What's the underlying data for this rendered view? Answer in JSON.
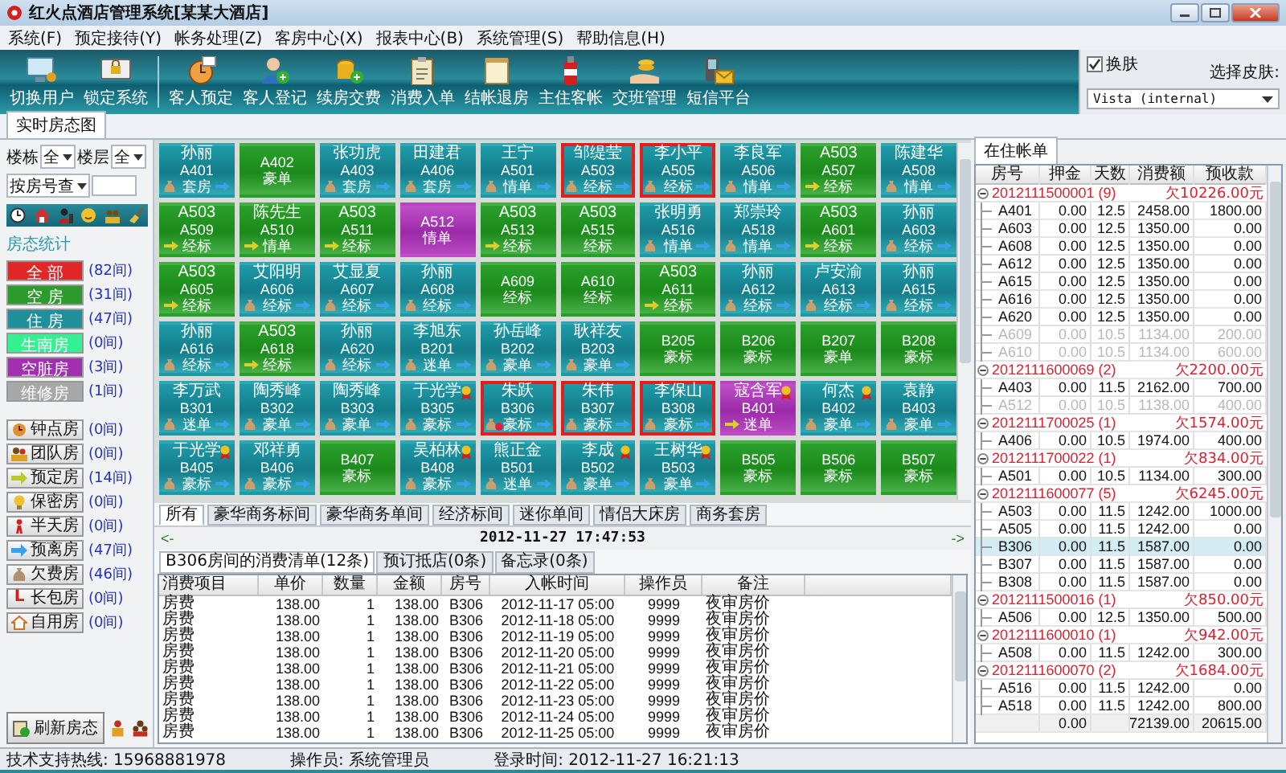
{
  "window": {
    "title": "红火点酒店管理系统[某某大酒店]"
  },
  "menu": [
    "系统(F)",
    "预定接待(Y)",
    "帐务处理(Z)",
    "客房中心(X)",
    "报表中心(B)",
    "系统管理(S)",
    "帮助信息(H)"
  ],
  "toolbar": {
    "system": [
      {
        "label": "切换用户",
        "kind": "user"
      },
      {
        "label": "锁定系统",
        "kind": "lock"
      }
    ],
    "guest": [
      {
        "label": "客人预定",
        "kind": "clock"
      },
      {
        "label": "客人登记",
        "kind": "person-add"
      },
      {
        "label": "续房交费",
        "kind": "coins"
      },
      {
        "label": "消费入单",
        "kind": "clipboard"
      },
      {
        "label": "结帐退房",
        "kind": "note"
      },
      {
        "label": "主住客帐",
        "kind": "bottle"
      },
      {
        "label": "交班管理",
        "kind": "hand"
      },
      {
        "label": "短信平台",
        "kind": "phone"
      }
    ]
  },
  "skin": {
    "toggle_label": "换肤",
    "checked": true,
    "label": "选择皮肤:",
    "value": "Vista (internal)"
  },
  "main_tabs": [
    {
      "label": "实时房态图",
      "selected": true
    }
  ],
  "filters": {
    "building_label": "楼栋",
    "building": "全",
    "floor_label": "楼层",
    "floor": "全",
    "search_mode": "按房号查"
  },
  "status_heading": "房态统计",
  "status_counts": [
    {
      "label": "全 部",
      "count": "(82间)",
      "color": "#e02828"
    },
    {
      "label": "空 房",
      "count": "(31间)",
      "color": "#2c9a2c"
    },
    {
      "label": "住 房",
      "count": "(47间)",
      "color": "#1f8f99"
    },
    {
      "label": "生南房",
      "count": "(0间)",
      "color": "#33f090"
    },
    {
      "label": "空脏房",
      "count": "(3间)",
      "color": "#a030b0"
    },
    {
      "label": "维修房",
      "count": "(1间)",
      "color": "#a8a8a8"
    }
  ],
  "room_types": [
    {
      "label": "钟点房",
      "count": "(0间)",
      "kind": "clock"
    },
    {
      "label": "团队房",
      "count": "(0间)",
      "kind": "team"
    },
    {
      "label": "预定房",
      "count": "(14间)",
      "kind": "reserve"
    },
    {
      "label": "保密房",
      "count": "(0间)",
      "kind": "bulb"
    },
    {
      "label": "半天房",
      "count": "(0间)",
      "kind": "half"
    },
    {
      "label": "预离房",
      "count": "(47间)",
      "kind": "leave"
    },
    {
      "label": "欠费房",
      "count": "(46间)",
      "kind": "bag"
    },
    {
      "label": "长包房",
      "count": "(0间)",
      "kind": "letter",
      "glyph": "L"
    },
    {
      "label": "自用房",
      "count": "(0间)",
      "kind": "house"
    }
  ],
  "refresh_label": "刷新房态",
  "rooms": [
    {
      "name": "孙丽",
      "room": "A401",
      "type": "套房",
      "kind": "occupied",
      "arrears": true,
      "departing": true,
      "reserved": false,
      "vip": false,
      "selected": false,
      "alert": false
    },
    {
      "room": "A402",
      "type": "豪单",
      "kind": "vacant",
      "arrears": false,
      "departing": false,
      "reserved": false,
      "vip": false,
      "selected": false,
      "alert": false
    },
    {
      "name": "张功虎",
      "room": "A403",
      "type": "套房",
      "kind": "occupied",
      "arrears": true,
      "departing": true,
      "reserved": false,
      "vip": false,
      "selected": false,
      "alert": false
    },
    {
      "name": "田建君",
      "room": "A406",
      "type": "套房",
      "kind": "occupied",
      "arrears": true,
      "departing": true,
      "reserved": false,
      "vip": false,
      "selected": false,
      "alert": false
    },
    {
      "name": "王宁",
      "room": "A501",
      "type": "情单",
      "kind": "occupied",
      "arrears": true,
      "departing": true,
      "reserved": false,
      "vip": false,
      "selected": false,
      "alert": false
    },
    {
      "name": "邹缇莹",
      "room": "A503",
      "type": "经标",
      "kind": "occupied",
      "arrears": true,
      "departing": true,
      "reserved": false,
      "vip": false,
      "selected": true,
      "alert": false
    },
    {
      "name": "李小平",
      "room": "A505",
      "type": "经标",
      "kind": "occupied",
      "arrears": true,
      "departing": true,
      "reserved": false,
      "vip": false,
      "selected": true,
      "alert": false
    },
    {
      "name": "李良军",
      "room": "A506",
      "type": "情单",
      "kind": "occupied",
      "arrears": true,
      "departing": true,
      "reserved": false,
      "vip": false,
      "selected": false,
      "alert": false
    },
    {
      "name": "A503",
      "room": "A507",
      "type": "经标",
      "kind": "vacant",
      "arrears": false,
      "departing": false,
      "reserved": true,
      "vip": false,
      "selected": false,
      "alert": false
    },
    {
      "name": "陈建华",
      "room": "A508",
      "type": "情单",
      "kind": "occupied",
      "arrears": true,
      "departing": true,
      "reserved": false,
      "vip": false,
      "selected": false,
      "alert": false
    },
    {
      "name": "A503",
      "room": "A509",
      "type": "经标",
      "kind": "vacant",
      "arrears": false,
      "departing": false,
      "reserved": true,
      "vip": false,
      "selected": false,
      "alert": false
    },
    {
      "name": "陈先生",
      "room": "A510",
      "type": "情单",
      "kind": "vacant",
      "arrears": false,
      "departing": false,
      "reserved": true,
      "vip": false,
      "selected": false,
      "alert": false
    },
    {
      "name": "A503",
      "room": "A511",
      "type": "经标",
      "kind": "vacant",
      "arrears": false,
      "departing": false,
      "reserved": true,
      "vip": false,
      "selected": false,
      "alert": false
    },
    {
      "room": "A512",
      "type": "情单",
      "kind": "dirty",
      "arrears": false,
      "departing": false,
      "reserved": false,
      "vip": false,
      "selected": false,
      "alert": false
    },
    {
      "name": "A503",
      "room": "A513",
      "type": "经标",
      "kind": "vacant",
      "arrears": false,
      "departing": false,
      "reserved": true,
      "vip": false,
      "selected": false,
      "alert": false
    },
    {
      "name": "A503",
      "room": "A515",
      "type": "经标",
      "kind": "vacant",
      "arrears": false,
      "departing": false,
      "reserved": false,
      "vip": false,
      "selected": false,
      "alert": false
    },
    {
      "name": "张明勇",
      "room": "A516",
      "type": "情单",
      "kind": "occupied",
      "arrears": true,
      "departing": true,
      "reserved": false,
      "vip": false,
      "selected": false,
      "alert": false
    },
    {
      "name": "郑崇玲",
      "room": "A518",
      "type": "情单",
      "kind": "occupied",
      "arrears": true,
      "departing": true,
      "reserved": false,
      "vip": false,
      "selected": false,
      "alert": false
    },
    {
      "name": "A503",
      "room": "A601",
      "type": "经标",
      "kind": "vacant",
      "arrears": false,
      "departing": false,
      "reserved": true,
      "vip": false,
      "selected": false,
      "alert": false
    },
    {
      "name": "孙丽",
      "room": "A603",
      "type": "经标",
      "kind": "occupied",
      "arrears": true,
      "departing": true,
      "reserved": false,
      "vip": false,
      "selected": false,
      "alert": false
    },
    {
      "name": "A503",
      "room": "A605",
      "type": "经标",
      "kind": "vacant",
      "arrears": false,
      "departing": false,
      "reserved": true,
      "vip": false,
      "selected": false,
      "alert": false
    },
    {
      "name": "艾阳明",
      "room": "A606",
      "type": "经标",
      "kind": "occupied",
      "arrears": true,
      "departing": true,
      "reserved": false,
      "vip": false,
      "selected": false,
      "alert": false
    },
    {
      "name": "艾显夏",
      "room": "A607",
      "type": "经标",
      "kind": "occupied",
      "arrears": true,
      "departing": true,
      "reserved": false,
      "vip": false,
      "selected": false,
      "alert": false
    },
    {
      "name": "孙丽",
      "room": "A608",
      "type": "经标",
      "kind": "occupied",
      "arrears": true,
      "departing": true,
      "reserved": false,
      "vip": false,
      "selected": false,
      "alert": false
    },
    {
      "room": "A609",
      "type": "经标",
      "kind": "vacant",
      "arrears": false,
      "departing": false,
      "reserved": false,
      "vip": false,
      "selected": false,
      "alert": false
    },
    {
      "room": "A610",
      "type": "经标",
      "kind": "vacant",
      "arrears": false,
      "departing": false,
      "reserved": false,
      "vip": false,
      "selected": false,
      "alert": false
    },
    {
      "name": "A503",
      "room": "A611",
      "type": "经标",
      "kind": "vacant",
      "arrears": false,
      "departing": false,
      "reserved": true,
      "vip": false,
      "selected": false,
      "alert": false
    },
    {
      "name": "孙丽",
      "room": "A612",
      "type": "经标",
      "kind": "occupied",
      "arrears": true,
      "departing": true,
      "reserved": false,
      "vip": false,
      "selected": false,
      "alert": false
    },
    {
      "name": "卢安渝",
      "room": "A613",
      "type": "经标",
      "kind": "occupied",
      "arrears": true,
      "departing": true,
      "reserved": false,
      "vip": false,
      "selected": false,
      "alert": false
    },
    {
      "name": "孙丽",
      "room": "A615",
      "type": "经标",
      "kind": "occupied",
      "arrears": true,
      "departing": true,
      "reserved": false,
      "vip": false,
      "selected": false,
      "alert": false
    },
    {
      "name": "孙丽",
      "room": "A616",
      "type": "经标",
      "kind": "occupied",
      "arrears": true,
      "departing": true,
      "reserved": false,
      "vip": false,
      "selected": false,
      "alert": false
    },
    {
      "name": "A503",
      "room": "A618",
      "type": "经标",
      "kind": "vacant",
      "arrears": false,
      "departing": false,
      "reserved": true,
      "vip": false,
      "selected": false,
      "alert": false
    },
    {
      "name": "孙丽",
      "room": "A620",
      "type": "经标",
      "kind": "occupied",
      "arrears": true,
      "departing": true,
      "reserved": false,
      "vip": false,
      "selected": false,
      "alert": false
    },
    {
      "name": "李旭东",
      "room": "B201",
      "type": "迷单",
      "kind": "occupied",
      "arrears": true,
      "departing": true,
      "reserved": false,
      "vip": false,
      "selected": false,
      "alert": false
    },
    {
      "name": "孙岳峰",
      "room": "B202",
      "type": "豪单",
      "kind": "occupied",
      "arrears": true,
      "departing": true,
      "reserved": false,
      "vip": false,
      "selected": false,
      "alert": false
    },
    {
      "name": "耿祥友",
      "room": "B203",
      "type": "豪单",
      "kind": "occupied",
      "arrears": true,
      "departing": true,
      "reserved": false,
      "vip": false,
      "selected": false,
      "alert": false
    },
    {
      "room": "B205",
      "type": "豪标",
      "kind": "vacant",
      "arrears": false,
      "departing": false,
      "reserved": false,
      "vip": false,
      "selected": false,
      "alert": false
    },
    {
      "room": "B206",
      "type": "豪标",
      "kind": "vacant",
      "arrears": false,
      "departing": false,
      "reserved": false,
      "vip": false,
      "selected": false,
      "alert": false
    },
    {
      "room": "B207",
      "type": "豪单",
      "kind": "vacant",
      "arrears": false,
      "departing": false,
      "reserved": false,
      "vip": false,
      "selected": false,
      "alert": false
    },
    {
      "room": "B208",
      "type": "豪标",
      "kind": "vacant",
      "arrears": false,
      "departing": false,
      "reserved": false,
      "vip": false,
      "selected": false,
      "alert": false
    },
    {
      "name": "李万武",
      "room": "B301",
      "type": "迷单",
      "kind": "occupied",
      "arrears": true,
      "departing": true,
      "reserved": false,
      "vip": false,
      "selected": false,
      "alert": false
    },
    {
      "name": "陶秀峰",
      "room": "B302",
      "type": "豪单",
      "kind": "occupied",
      "arrears": true,
      "departing": true,
      "reserved": false,
      "vip": false,
      "selected": false,
      "alert": false
    },
    {
      "name": "陶秀峰",
      "room": "B303",
      "type": "豪单",
      "kind": "occupied",
      "arrears": true,
      "departing": true,
      "reserved": false,
      "vip": false,
      "selected": false,
      "alert": false
    },
    {
      "name": "于光学",
      "room": "B305",
      "type": "豪标",
      "kind": "occupied",
      "arrears": true,
      "departing": true,
      "reserved": false,
      "vip": true,
      "selected": false,
      "alert": false
    },
    {
      "name": "朱跃",
      "room": "B306",
      "type": "豪标",
      "kind": "occupied",
      "arrears": true,
      "departing": true,
      "reserved": false,
      "vip": false,
      "selected": true,
      "alert": true
    },
    {
      "name": "朱伟",
      "room": "B307",
      "type": "豪标",
      "kind": "occupied",
      "arrears": true,
      "departing": true,
      "reserved": false,
      "vip": false,
      "selected": true,
      "alert": false
    },
    {
      "name": "李保山",
      "room": "B308",
      "type": "豪标",
      "kind": "occupied",
      "arrears": true,
      "departing": true,
      "reserved": false,
      "vip": false,
      "selected": true,
      "alert": false
    },
    {
      "name": "寇含军",
      "room": "B401",
      "type": "迷单",
      "kind": "dirty",
      "arrears": false,
      "departing": false,
      "reserved": true,
      "vip": true,
      "selected": false,
      "alert": false
    },
    {
      "name": "何杰",
      "room": "B402",
      "type": "豪单",
      "kind": "occupied",
      "arrears": true,
      "departing": true,
      "reserved": false,
      "vip": true,
      "selected": false,
      "alert": false
    },
    {
      "name": "袁静",
      "room": "B403",
      "type": "豪单",
      "kind": "occupied",
      "arrears": true,
      "departing": true,
      "reserved": false,
      "vip": false,
      "selected": false,
      "alert": false
    },
    {
      "name": "于光学",
      "room": "B405",
      "type": "豪标",
      "kind": "occupied",
      "arrears": true,
      "departing": true,
      "reserved": false,
      "vip": true,
      "selected": false,
      "alert": false
    },
    {
      "name": "邓祥勇",
      "room": "B406",
      "type": "豪标",
      "kind": "occupied",
      "arrears": true,
      "departing": true,
      "reserved": false,
      "vip": false,
      "selected": false,
      "alert": false
    },
    {
      "room": "B407",
      "type": "豪标",
      "kind": "vacant",
      "arrears": false,
      "departing": false,
      "reserved": false,
      "vip": false,
      "selected": false,
      "alert": false
    },
    {
      "name": "吴柏林",
      "room": "B408",
      "type": "豪标",
      "kind": "occupied",
      "arrears": true,
      "departing": true,
      "reserved": false,
      "vip": true,
      "selected": false,
      "alert": false
    },
    {
      "name": "熊正金",
      "room": "B501",
      "type": "迷单",
      "kind": "occupied",
      "arrears": true,
      "departing": true,
      "reserved": false,
      "vip": false,
      "selected": false,
      "alert": false
    },
    {
      "name": "李成",
      "room": "B502",
      "type": "豪单",
      "kind": "occupied",
      "arrears": true,
      "departing": true,
      "reserved": false,
      "vip": true,
      "selected": false,
      "alert": false
    },
    {
      "name": "王树华",
      "room": "B503",
      "type": "豪单",
      "kind": "occupied",
      "arrears": true,
      "departing": true,
      "reserved": false,
      "vip": true,
      "selected": false,
      "alert": false
    },
    {
      "room": "B505",
      "type": "豪标",
      "kind": "vacant",
      "arrears": false,
      "departing": false,
      "reserved": false,
      "vip": false,
      "selected": false,
      "alert": false
    },
    {
      "room": "B506",
      "type": "豪标",
      "kind": "vacant",
      "arrears": false,
      "departing": false,
      "reserved": false,
      "vip": false,
      "selected": false,
      "alert": false
    },
    {
      "room": "B507",
      "type": "豪标",
      "kind": "vacant",
      "arrears": false,
      "departing": false,
      "reserved": false,
      "vip": false,
      "selected": false,
      "alert": false
    }
  ],
  "categories": [
    {
      "label": "所有",
      "selected": true
    },
    {
      "label": "豪华商务标间",
      "selected": false
    },
    {
      "label": "豪华商务单间",
      "selected": false
    },
    {
      "label": "经济标间",
      "selected": false
    },
    {
      "label": "迷你单间",
      "selected": false
    },
    {
      "label": "情侣大床房",
      "selected": false
    },
    {
      "label": "商务套房",
      "selected": false
    }
  ],
  "nav": {
    "prev": "<-",
    "datetime": "2012-11-27 17:47:53",
    "next": "->"
  },
  "detail_tabs": [
    {
      "label": "B306房间的消费清单(12条)",
      "selected": true
    },
    {
      "label": "预订抵店(0条)",
      "selected": false
    },
    {
      "label": "备忘录(0条)",
      "selected": false
    }
  ],
  "charges": {
    "columns": [
      "消费项目",
      "单价",
      "数量",
      "金额",
      "房号",
      "入帐时间",
      "操作员",
      "备注"
    ],
    "rows": [
      [
        "房费",
        "138.00",
        "1",
        "138.00",
        "B306",
        "2012-11-17 05:00",
        "9999",
        "夜审房价"
      ],
      [
        "房费",
        "138.00",
        "1",
        "138.00",
        "B306",
        "2012-11-18 05:00",
        "9999",
        "夜审房价"
      ],
      [
        "房费",
        "138.00",
        "1",
        "138.00",
        "B306",
        "2012-11-19 05:00",
        "9999",
        "夜审房价"
      ],
      [
        "房费",
        "138.00",
        "1",
        "138.00",
        "B306",
        "2012-11-20 05:00",
        "9999",
        "夜审房价"
      ],
      [
        "房费",
        "138.00",
        "1",
        "138.00",
        "B306",
        "2012-11-21 05:00",
        "9999",
        "夜审房价"
      ],
      [
        "房费",
        "138.00",
        "1",
        "138.00",
        "B306",
        "2012-11-22 05:00",
        "9999",
        "夜审房价"
      ],
      [
        "房费",
        "138.00",
        "1",
        "138.00",
        "B306",
        "2012-11-23 05:00",
        "9999",
        "夜审房价"
      ],
      [
        "房费",
        "138.00",
        "1",
        "138.00",
        "B306",
        "2012-11-24 05:00",
        "9999",
        "夜审房价"
      ],
      [
        "房费",
        "138.00",
        "1",
        "138.00",
        "B306",
        "2012-11-25 05:00",
        "9999",
        "夜审房价"
      ]
    ]
  },
  "accounts": {
    "tab": "在住帐单",
    "columns": [
      "房号",
      "押金",
      "天数",
      "消费额",
      "预收款"
    ],
    "groups": [
      {
        "id": "2012111500001 (9)",
        "owed": "欠10226.00元",
        "expanded": true,
        "rows": [
          {
            "room": "A401",
            "deposit": "0.00",
            "days": "12.5",
            "spent": "2458.00",
            "prepaid": "1800.00",
            "disabled": false,
            "selected": false
          },
          {
            "room": "A603",
            "deposit": "0.00",
            "days": "12.5",
            "spent": "1350.00",
            "prepaid": "0.00",
            "disabled": false,
            "selected": false
          },
          {
            "room": "A608",
            "deposit": "0.00",
            "days": "12.5",
            "spent": "1350.00",
            "prepaid": "0.00",
            "disabled": false,
            "selected": false
          },
          {
            "room": "A612",
            "deposit": "0.00",
            "days": "12.5",
            "spent": "1350.00",
            "prepaid": "0.00",
            "disabled": false,
            "selected": false
          },
          {
            "room": "A615",
            "deposit": "0.00",
            "days": "12.5",
            "spent": "1350.00",
            "prepaid": "0.00",
            "disabled": false,
            "selected": false
          },
          {
            "room": "A616",
            "deposit": "0.00",
            "days": "12.5",
            "spent": "1350.00",
            "prepaid": "0.00",
            "disabled": false,
            "selected": false
          },
          {
            "room": "A620",
            "deposit": "0.00",
            "days": "12.5",
            "spent": "1350.00",
            "prepaid": "0.00",
            "disabled": false,
            "selected": false
          },
          {
            "room": "A609",
            "deposit": "0.00",
            "days": "10.5",
            "spent": "1134.00",
            "prepaid": "200.00",
            "disabled": true,
            "selected": false
          },
          {
            "room": "A610",
            "deposit": "0.00",
            "days": "10.5",
            "spent": "1134.00",
            "prepaid": "600.00",
            "disabled": true,
            "selected": false
          }
        ]
      },
      {
        "id": "2012111600069 (2)",
        "owed": "欠2200.00元",
        "expanded": true,
        "rows": [
          {
            "room": "A403",
            "deposit": "0.00",
            "days": "11.5",
            "spent": "2162.00",
            "prepaid": "700.00",
            "disabled": false,
            "selected": false
          },
          {
            "room": "A512",
            "deposit": "0.00",
            "days": "10.5",
            "spent": "1138.00",
            "prepaid": "400.00",
            "disabled": true,
            "selected": false
          }
        ]
      },
      {
        "id": "2012111700025 (1)",
        "owed": "欠1574.00元",
        "expanded": true,
        "rows": [
          {
            "room": "A406",
            "deposit": "0.00",
            "days": "10.5",
            "spent": "1974.00",
            "prepaid": "400.00",
            "disabled": false,
            "selected": false
          }
        ]
      },
      {
        "id": "2012111700022 (1)",
        "owed": "欠834.00元",
        "expanded": true,
        "rows": [
          {
            "room": "A501",
            "deposit": "0.00",
            "days": "10.5",
            "spent": "1134.00",
            "prepaid": "300.00",
            "disabled": false,
            "selected": false
          }
        ]
      },
      {
        "id": "2012111600077 (5)",
        "owed": "欠6245.00元",
        "expanded": true,
        "rows": [
          {
            "room": "A503",
            "deposit": "0.00",
            "days": "11.5",
            "spent": "1242.00",
            "prepaid": "1000.00",
            "disabled": false,
            "selected": false
          },
          {
            "room": "A505",
            "deposit": "0.00",
            "days": "11.5",
            "spent": "1242.00",
            "prepaid": "0.00",
            "disabled": false,
            "selected": false
          },
          {
            "room": "B306",
            "deposit": "0.00",
            "days": "11.5",
            "spent": "1587.00",
            "prepaid": "0.00",
            "disabled": false,
            "selected": true
          },
          {
            "room": "B307",
            "deposit": "0.00",
            "days": "11.5",
            "spent": "1587.00",
            "prepaid": "0.00",
            "disabled": false,
            "selected": false
          },
          {
            "room": "B308",
            "deposit": "0.00",
            "days": "11.5",
            "spent": "1587.00",
            "prepaid": "0.00",
            "disabled": false,
            "selected": false
          }
        ]
      },
      {
        "id": "2012111500016 (1)",
        "owed": "欠850.00元",
        "expanded": true,
        "rows": [
          {
            "room": "A506",
            "deposit": "0.00",
            "days": "12.5",
            "spent": "1350.00",
            "prepaid": "500.00",
            "disabled": false,
            "selected": false
          }
        ]
      },
      {
        "id": "2012111600010 (1)",
        "owed": "欠942.00元",
        "expanded": true,
        "rows": [
          {
            "room": "A508",
            "deposit": "0.00",
            "days": "11.5",
            "spent": "1242.00",
            "prepaid": "300.00",
            "disabled": false,
            "selected": false
          }
        ]
      },
      {
        "id": "2012111600070 (2)",
        "owed": "欠1684.00元",
        "expanded": true,
        "rows": [
          {
            "room": "A516",
            "deposit": "0.00",
            "days": "11.5",
            "spent": "1242.00",
            "prepaid": "0.00",
            "disabled": false,
            "selected": false
          },
          {
            "room": "A518",
            "deposit": "0.00",
            "days": "11.5",
            "spent": "1242.00",
            "prepaid": "800.00",
            "disabled": false,
            "selected": false
          }
        ]
      }
    ],
    "totals": {
      "deposit": "0.00",
      "spent": "72139.00",
      "prepaid": "20615.00"
    }
  },
  "status_bar": {
    "hotline": "技术支持热线: 15968881978",
    "operator": "操作员: 系统管理员",
    "login": "登录时间: 2012-11-27 16:21:13"
  }
}
